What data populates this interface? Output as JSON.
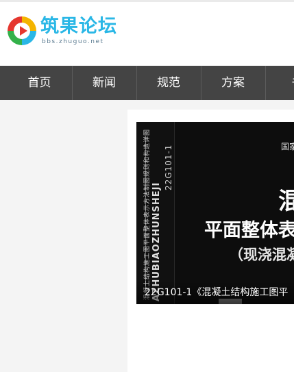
{
  "logo": {
    "title": "筑果论坛",
    "subtitle": "bbs.zhuguo.net"
  },
  "nav": {
    "items": [
      {
        "label": "首页"
      },
      {
        "label": "新闻"
      },
      {
        "label": "规范"
      },
      {
        "label": "方案"
      },
      {
        "label": "书"
      }
    ]
  },
  "feature": {
    "cover": {
      "tag": "国家",
      "big": "混",
      "line1": "平面整体表示",
      "line2": "（现浇混凝",
      "spine_code": "22G101-1",
      "spine_pinyin": "AZHUBIAOZHUNSHEJI",
      "spine_title": "混凝土结构施工图平面整体表示方法制图规则和构造详图"
    },
    "caption": "22G101-1《混凝土结构施工图平"
  },
  "colors": {
    "nav_bg": "#444444",
    "brand_blue": "#2ab7e6",
    "page_bg": "#f4f4f4"
  }
}
